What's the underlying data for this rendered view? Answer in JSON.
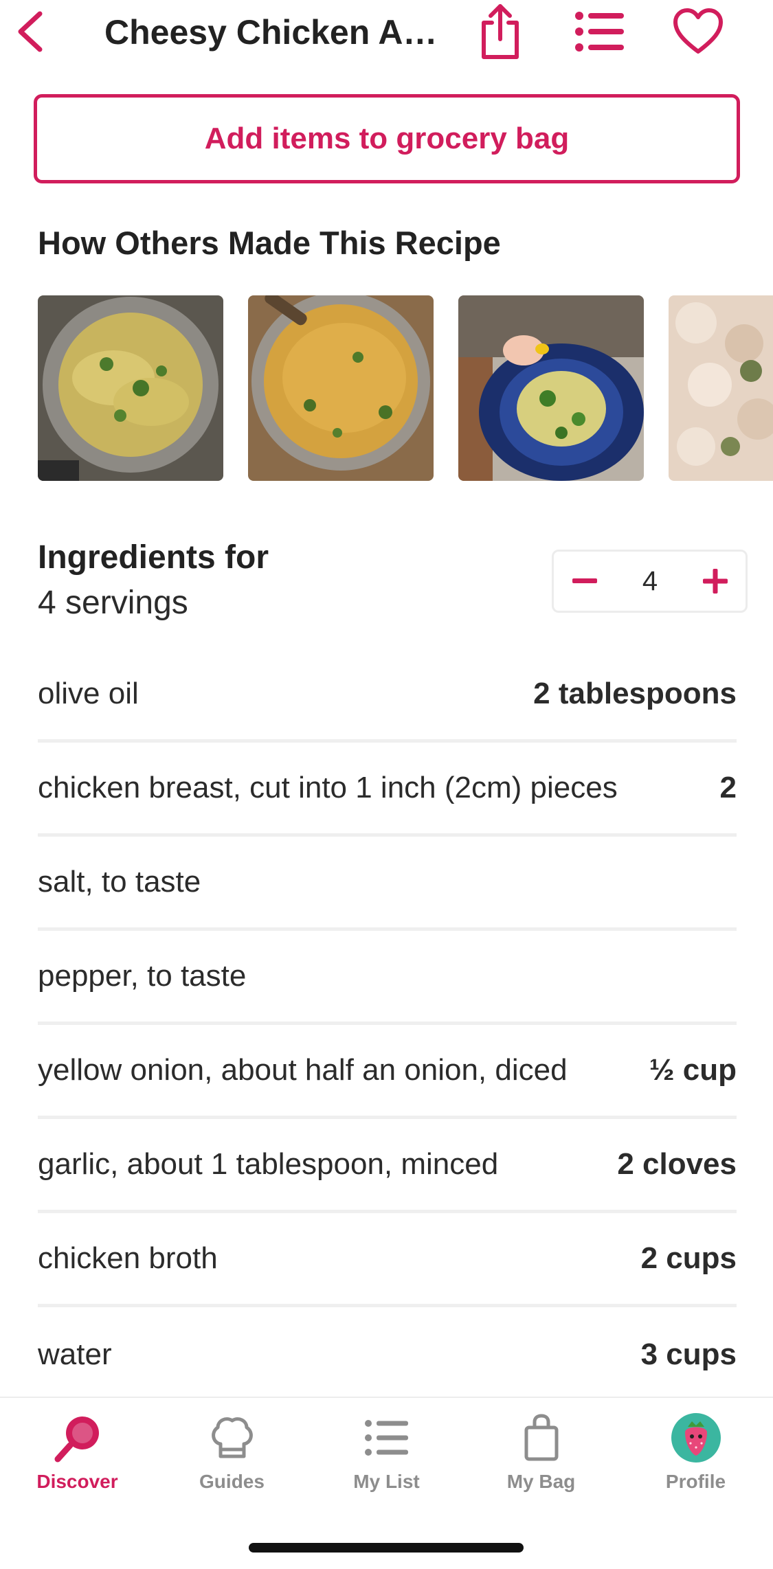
{
  "header": {
    "title": "Cheesy Chicken A…",
    "back_icon": "chevron-left-icon",
    "share_icon": "share-icon",
    "list_icon": "list-icon",
    "favorite_icon": "heart-icon"
  },
  "grocery_button": {
    "label": "Add items to grocery bag"
  },
  "others": {
    "title": "How Others Made This Recipe",
    "photo_count_visible": 4
  },
  "ingredients": {
    "title": "Ingredients for",
    "servings_text": "4 servings",
    "stepper": {
      "value": "4",
      "minus_icon": "minus-icon",
      "plus_icon": "plus-icon"
    },
    "items": [
      {
        "name": "olive oil",
        "qty": "2 tablespoons"
      },
      {
        "name": "chicken breast, cut into 1 inch (2cm) pieces",
        "qty": "2"
      },
      {
        "name": "salt, to taste",
        "qty": ""
      },
      {
        "name": "pepper, to taste",
        "qty": ""
      },
      {
        "name": "yellow onion, about half an onion, diced",
        "qty": "½ cup"
      },
      {
        "name": "garlic, about 1 tablespoon, minced",
        "qty": "2 cloves"
      },
      {
        "name": "chicken broth",
        "qty": "2 cups"
      },
      {
        "name": "water",
        "qty": "3 cups"
      }
    ]
  },
  "tabbar": {
    "tabs": [
      {
        "label": "Discover",
        "icon": "search-icon",
        "active": true
      },
      {
        "label": "Guides",
        "icon": "chef-hat-icon",
        "active": false
      },
      {
        "label": "My List",
        "icon": "list-icon",
        "active": false
      },
      {
        "label": "My Bag",
        "icon": "shopping-bag-icon",
        "active": false
      },
      {
        "label": "Profile",
        "icon": "avatar-icon",
        "active": false
      }
    ]
  },
  "colors": {
    "accent": "#d11d5c",
    "text": "#2b2b2b",
    "muted": "#8d8d8d",
    "divider": "#efefef"
  }
}
